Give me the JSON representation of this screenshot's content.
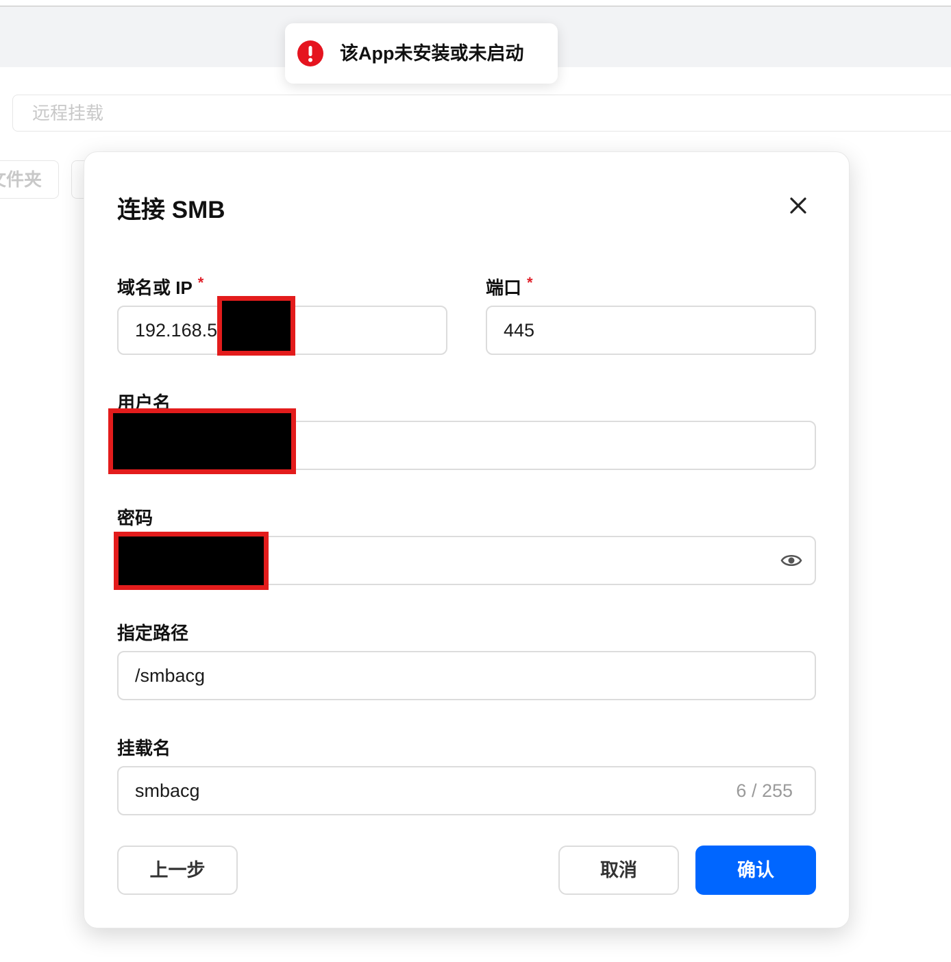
{
  "background": {
    "search_placeholder": "远程挂载",
    "chip_label": "文件夹"
  },
  "toast": {
    "message": "该App未安装或未启动",
    "icon": "error-icon",
    "color": "#e5141f"
  },
  "dialog": {
    "title": "连接 SMB",
    "close_icon": "close-icon",
    "host": {
      "label": "域名或 IP",
      "required_mark": "*",
      "value": "192.168.5"
    },
    "port": {
      "label": "端口",
      "required_mark": "*",
      "value": "445"
    },
    "username": {
      "label": "用户名",
      "value": ""
    },
    "password": {
      "label": "密码",
      "value": "",
      "icon": "eye-icon"
    },
    "path": {
      "label": "指定路径",
      "value": "/smbacg"
    },
    "mount_name": {
      "label": "挂载名",
      "value": "smbacg",
      "counter": "6 / 255"
    },
    "buttons": {
      "back": "上一步",
      "cancel": "取消",
      "confirm": "确认"
    }
  },
  "colors": {
    "primary": "#0066ff",
    "required": "#e0202a",
    "redaction_border": "#e31c1c"
  }
}
